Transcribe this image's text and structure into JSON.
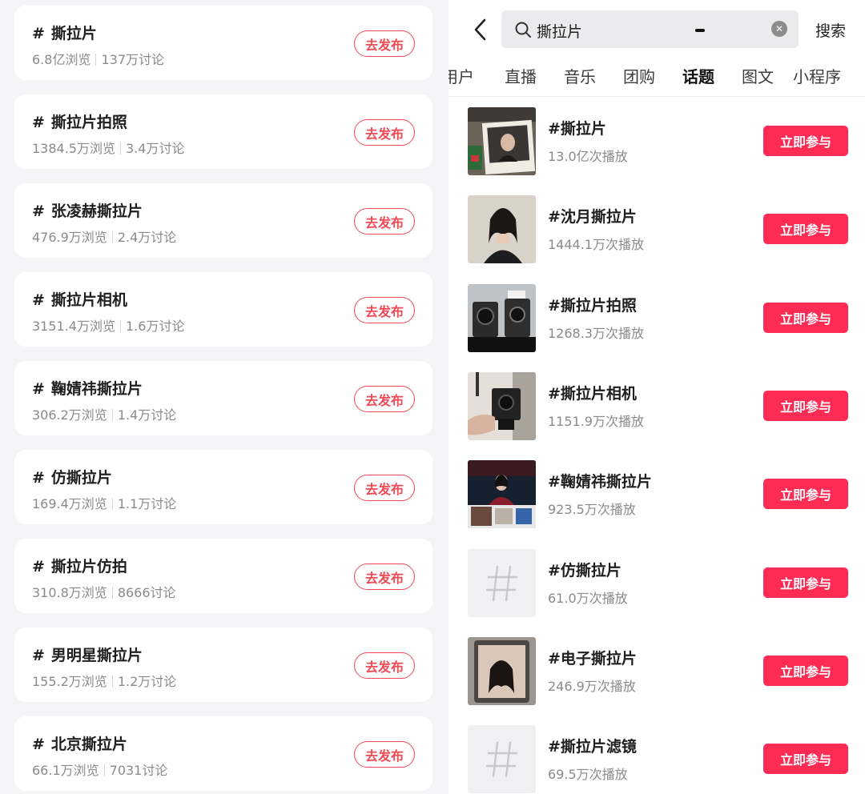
{
  "left_list": {
    "publish_label": "去发布",
    "hash_symbol": "#",
    "items": [
      {
        "title": "撕拉片",
        "views": "6.8亿浏览",
        "discussions": "137万讨论"
      },
      {
        "title": "撕拉片拍照",
        "views": "1384.5万浏览",
        "discussions": "3.4万讨论"
      },
      {
        "title": "张凌赫撕拉片",
        "views": "476.9万浏览",
        "discussions": "2.4万讨论"
      },
      {
        "title": "撕拉片相机",
        "views": "3151.4万浏览",
        "discussions": "1.6万讨论"
      },
      {
        "title": "鞠婧祎撕拉片",
        "views": "306.2万浏览",
        "discussions": "1.4万讨论"
      },
      {
        "title": "仿撕拉片",
        "views": "169.4万浏览",
        "discussions": "1.1万讨论"
      },
      {
        "title": "撕拉片仿拍",
        "views": "310.8万浏览",
        "discussions": "8666讨论"
      },
      {
        "title": "男明星撕拉片",
        "views": "155.2万浏览",
        "discussions": "1.2万讨论"
      },
      {
        "title": "北京撕拉片",
        "views": "66.1万浏览",
        "discussions": "7031讨论"
      }
    ]
  },
  "header": {
    "search_value": "撕拉片",
    "search_button": "搜索",
    "back_icon": "chevron-left-icon",
    "clear_icon": "clear-icon"
  },
  "tabs": [
    {
      "label": "用户",
      "active": false
    },
    {
      "label": "直播",
      "active": false
    },
    {
      "label": "音乐",
      "active": false
    },
    {
      "label": "团购",
      "active": false
    },
    {
      "label": "话题",
      "active": true
    },
    {
      "label": "图文",
      "active": false
    },
    {
      "label": "小程序",
      "active": false
    }
  ],
  "topics": {
    "join_label": "立即参与",
    "items": [
      {
        "title": "#撕拉片",
        "plays": "13.0亿次播放",
        "thumb": "photo-polaroid-woman"
      },
      {
        "title": "#沈月撕拉片",
        "plays": "1444.1万次播放",
        "thumb": "photo-portrait-woman"
      },
      {
        "title": "#撕拉片拍照",
        "plays": "1268.3万次播放",
        "thumb": "photo-cameras"
      },
      {
        "title": "#撕拉片相机",
        "plays": "1151.9万次播放",
        "thumb": "photo-camera-hand"
      },
      {
        "title": "#鞠婧祎撕拉片",
        "plays": "923.5万次播放",
        "thumb": "photo-stage-performer"
      },
      {
        "title": "#仿撕拉片",
        "plays": "61.0万次播放",
        "thumb": "hash-placeholder"
      },
      {
        "title": "#电子撕拉片",
        "plays": "246.9万次播放",
        "thumb": "photo-phone-selfie"
      },
      {
        "title": "#撕拉片滤镜",
        "plays": "69.5万次播放",
        "thumb": "hash-placeholder"
      }
    ]
  },
  "colors": {
    "accent": "#fe2c55",
    "publish_outline": "#f04a55",
    "left_background": "#f5f5f7",
    "search_background": "#ebebed"
  }
}
